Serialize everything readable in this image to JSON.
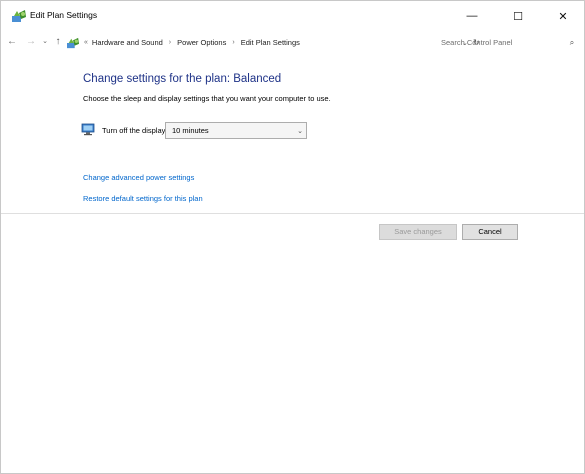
{
  "window": {
    "title": "Edit Plan Settings",
    "controls": {
      "minimize": "—",
      "maximize": "☐",
      "close": "✕"
    }
  },
  "navigation": {
    "back": "←",
    "forward": "→",
    "recent": "⌄",
    "up": "↑",
    "address_prefix": "«",
    "breadcrumbs": [
      "Hardware and Sound",
      "Power Options",
      "Edit Plan Settings"
    ],
    "separator": "›",
    "dropdown": "⌄",
    "refresh": "↻"
  },
  "search": {
    "placeholder": "Search Control Panel",
    "icon": "⌕"
  },
  "main": {
    "heading": "Change settings for the plan: Balanced",
    "subheading": "Choose the sleep and display settings that you want your computer to use.",
    "display_setting": {
      "label": "Turn off the display:",
      "value": "10 minutes",
      "arrow": "⌄"
    },
    "links": {
      "advanced": "Change advanced power settings",
      "restore": "Restore default settings for this plan"
    },
    "buttons": {
      "save": "Save changes",
      "cancel": "Cancel"
    }
  },
  "icons": {
    "title": "power-options-icon",
    "address": "power-options-icon",
    "display": "monitor-icon"
  },
  "colors": {
    "heading": "#1e3287",
    "link": "#0066cc"
  }
}
